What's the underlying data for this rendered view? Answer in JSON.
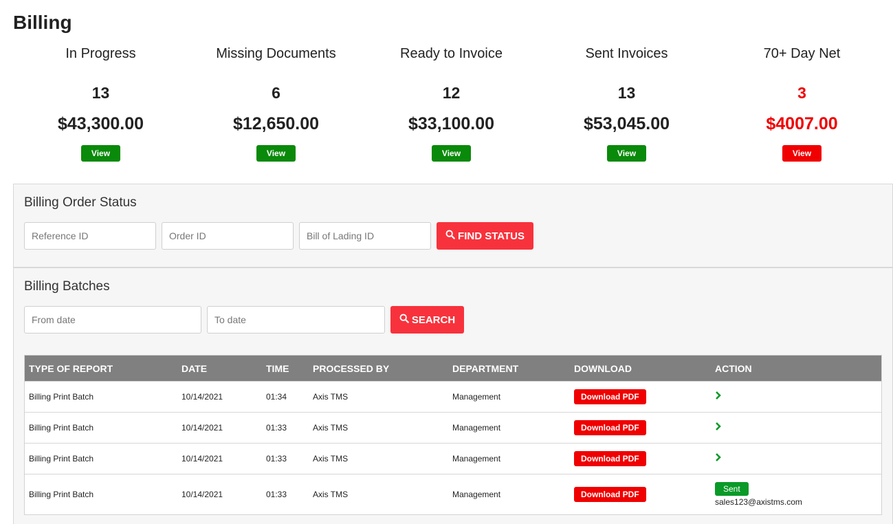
{
  "page": {
    "title": "Billing"
  },
  "summary": [
    {
      "label": "In Progress",
      "count": "13",
      "amount": "$43,300.00",
      "view_label": "View"
    },
    {
      "label": "Missing Documents",
      "count": "6",
      "amount": "$12,650.00",
      "view_label": "View"
    },
    {
      "label": "Ready to Invoice",
      "count": "12",
      "amount": "$33,100.00",
      "view_label": "View"
    },
    {
      "label": "Sent Invoices",
      "count": "13",
      "amount": "$53,045.00",
      "view_label": "View"
    },
    {
      "label": "70+ Day Net",
      "count": "3",
      "amount": "$4007.00",
      "view_label": "View"
    }
  ],
  "order_status": {
    "title": "Billing Order Status",
    "reference_placeholder": "Reference ID",
    "order_placeholder": "Order ID",
    "bol_placeholder": "Bill of Lading ID",
    "find_label": "FIND STATUS"
  },
  "batches": {
    "title": "Billing Batches",
    "from_placeholder": "From date",
    "to_placeholder": "To date",
    "search_label": "SEARCH",
    "columns": [
      "TYPE OF REPORT",
      "DATE",
      "TIME",
      "PROCESSED BY",
      "DEPARTMENT",
      "DOWNLOAD",
      "ACTION"
    ],
    "rows": [
      {
        "type": "Billing Print Batch",
        "date": "10/14/2021",
        "time": "01:34",
        "processed_by": "Axis TMS",
        "department": "Management",
        "download_label": "Download PDF"
      },
      {
        "type": "Billing Print Batch",
        "date": "10/14/2021",
        "time": "01:33",
        "processed_by": "Axis TMS",
        "department": "Management",
        "download_label": "Download PDF"
      },
      {
        "type": "Billing Print Batch",
        "date": "10/14/2021",
        "time": "01:33",
        "processed_by": "Axis TMS",
        "department": "Management",
        "download_label": "Download PDF"
      },
      {
        "type": "Billing Print Batch",
        "date": "10/14/2021",
        "time": "01:33",
        "processed_by": "Axis TMS",
        "department": "Management",
        "download_label": "Download PDF",
        "status": "Sent",
        "email": "sales123@axistms.com"
      }
    ]
  },
  "colors": {
    "green": "#0a8a0a",
    "red": "#f00000",
    "accent": "#f8323c",
    "header_gray": "#808080"
  },
  "icons": {
    "search": "search-icon",
    "action": "chevron-right-icon"
  }
}
